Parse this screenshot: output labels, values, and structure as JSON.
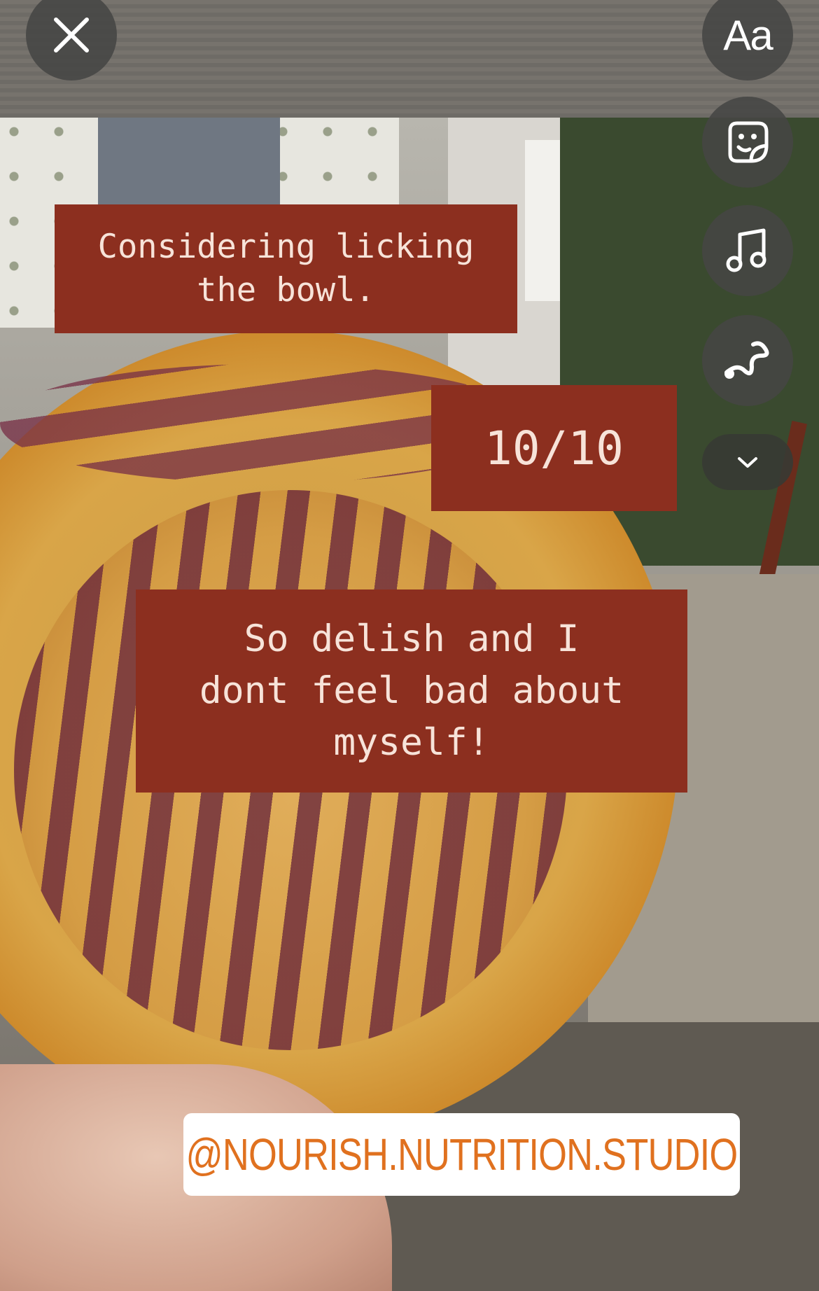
{
  "toolbar": {
    "text_tool_label": "Aa",
    "icons": {
      "close": "close-icon",
      "text": "text-icon",
      "sticker": "sticker-icon",
      "music": "music-note-icon",
      "draw": "draw-squiggle-icon",
      "more": "chevron-down-icon"
    }
  },
  "captions": [
    {
      "text": "Considering licking\nthe bowl.",
      "background": "#8c2f1f",
      "color": "#f7e3d9"
    },
    {
      "text": "10/10",
      "background": "#8c2f1f",
      "color": "#f7e3d9"
    },
    {
      "text": "So delish and I\ndont feel bad about\nmyself!",
      "background": "#8c2f1f",
      "color": "#f7e3d9"
    }
  ],
  "mention_sticker": {
    "text": "@NOURISH.NUTRITION.STUDIO",
    "color": "#e0711f"
  }
}
